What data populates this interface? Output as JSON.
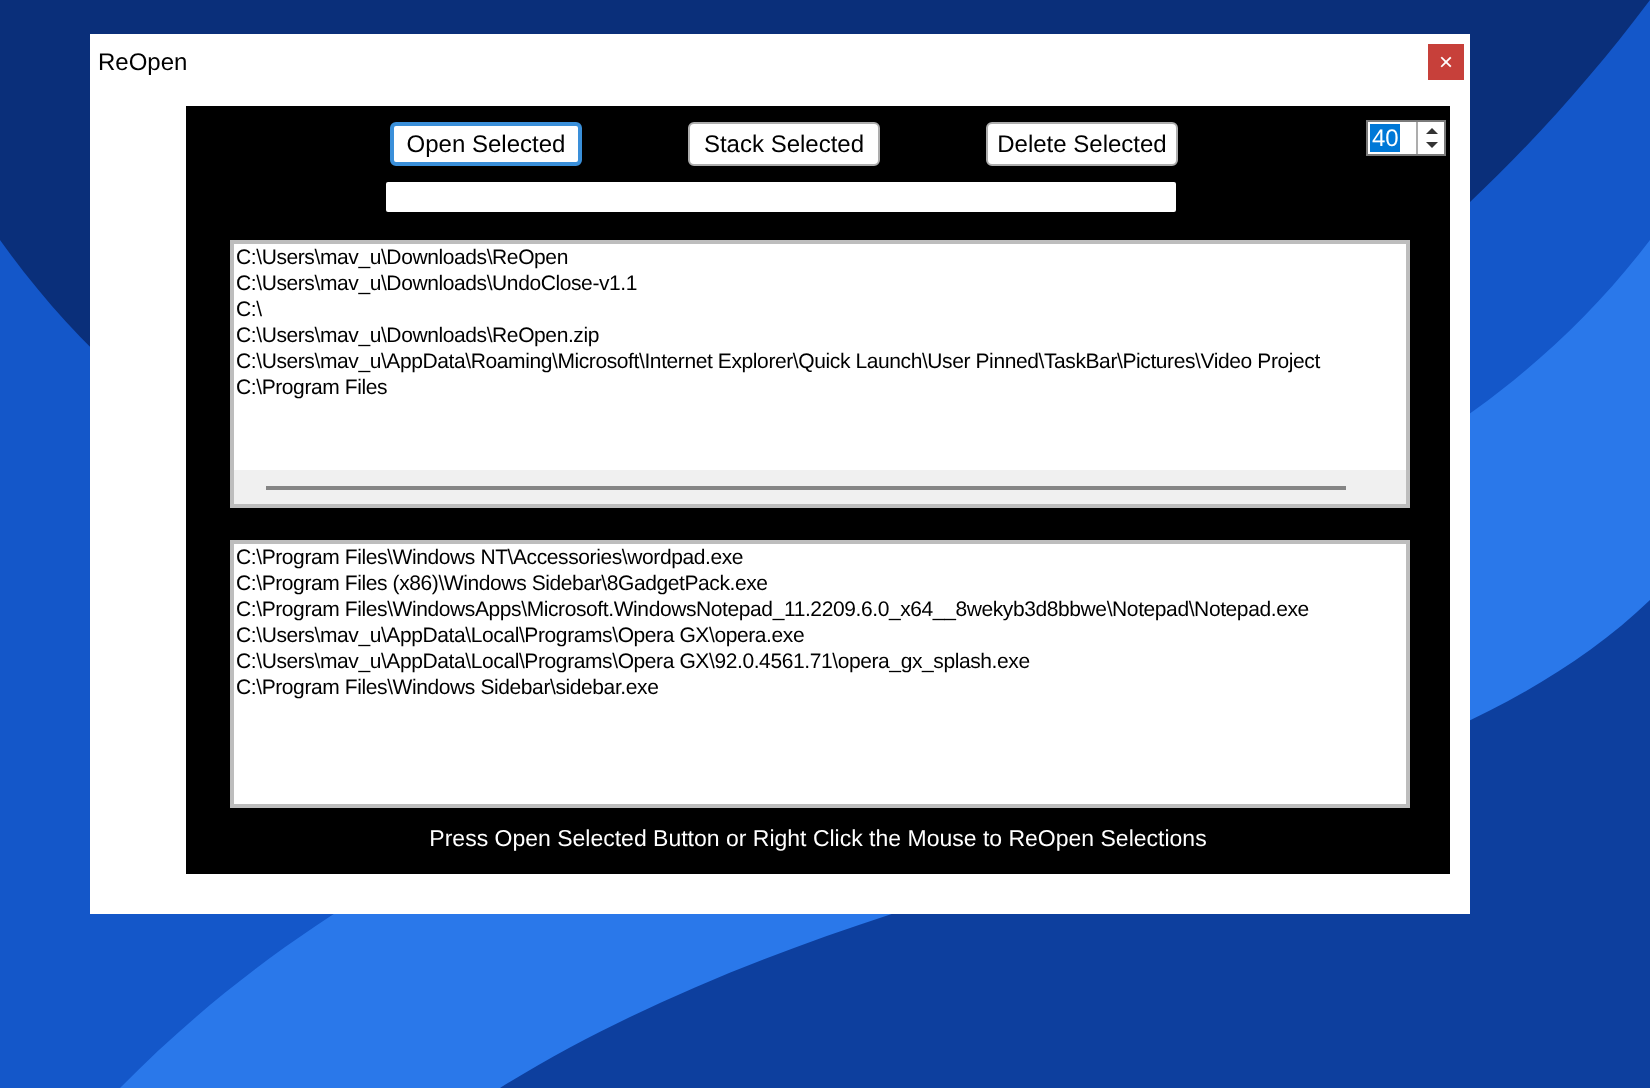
{
  "window": {
    "title": "ReOpen",
    "close": "×"
  },
  "buttons": [
    {
      "label": "Open Selected",
      "focused": true
    },
    {
      "label": "Stack Selected",
      "focused": false
    },
    {
      "label": "Delete Selected",
      "focused": false
    }
  ],
  "spin": {
    "value": "40",
    "selected": true
  },
  "folders": [
    "C:\\Users\\mav_u\\Downloads\\ReOpen",
    "C:\\Users\\mav_u\\Downloads\\UndoClose-v1.1",
    "C:\\",
    "C:\\Users\\mav_u\\Downloads\\ReOpen.zip",
    "C:\\Users\\mav_u\\AppData\\Roaming\\Microsoft\\Internet Explorer\\Quick Launch\\User Pinned\\TaskBar\\Pictures\\Video Project",
    "C:\\Program Files"
  ],
  "programs": [
    "C:\\Program Files\\Windows NT\\Accessories\\wordpad.exe",
    "C:\\Program Files (x86)\\Windows Sidebar\\8GadgetPack.exe",
    "C:\\Program Files\\WindowsApps\\Microsoft.WindowsNotepad_11.2209.6.0_x64__8wekyb3d8bbwe\\Notepad\\Notepad.exe",
    "C:\\Users\\mav_u\\AppData\\Local\\Programs\\Opera GX\\opera.exe",
    "C:\\Users\\mav_u\\AppData\\Local\\Programs\\Opera GX\\92.0.4561.71\\opera_gx_splash.exe",
    "C:\\Program Files\\Windows Sidebar\\sidebar.exe"
  ],
  "status": "Press Open Selected Button or Right Click the Mouse to ReOpen Selections"
}
